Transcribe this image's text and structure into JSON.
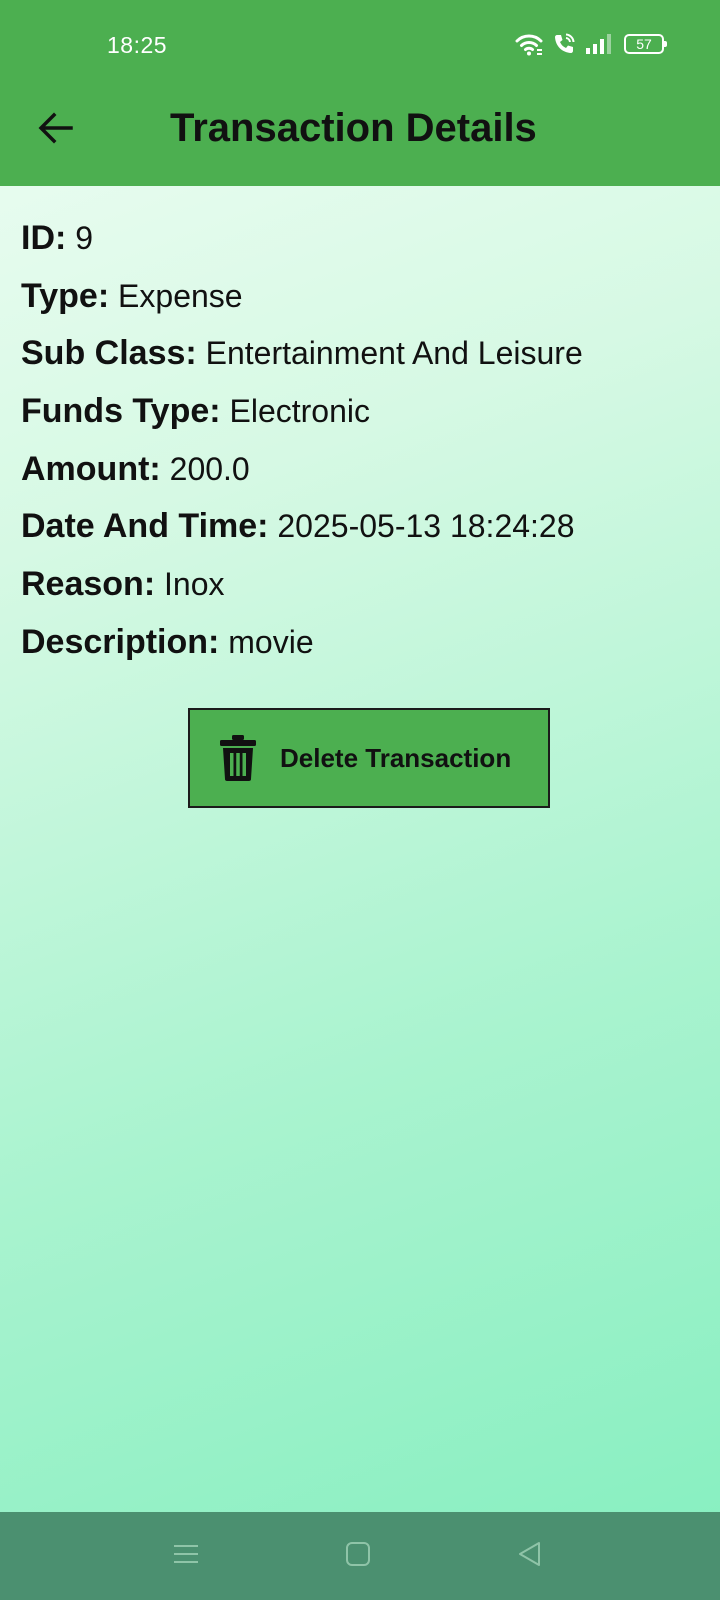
{
  "status_bar": {
    "time": "18:25",
    "battery_level": "57",
    "icons": [
      "wifi-icon",
      "wifi-calling-icon",
      "signal-icon",
      "battery-icon"
    ]
  },
  "app_bar": {
    "title": "Transaction Details",
    "back_icon": "arrow-back-icon",
    "background": "#4caf50"
  },
  "transaction": {
    "fields": [
      {
        "label": "ID:",
        "value": "9"
      },
      {
        "label": "Type:",
        "value": "Expense"
      },
      {
        "label": "Sub Class:",
        "value": "Entertainment And Leisure"
      },
      {
        "label": "Funds Type:",
        "value": "Electronic"
      },
      {
        "label": "Amount:",
        "value": "200.0"
      },
      {
        "label": "Date And Time:",
        "value": "2025-05-13 18:24:28"
      },
      {
        "label": "Reason:",
        "value": "Inox"
      },
      {
        "label": "Description:",
        "value": "movie"
      }
    ]
  },
  "actions": {
    "delete_label": "Delete Transaction",
    "delete_icon": "trash-icon"
  },
  "nav_bar": {
    "buttons": [
      "menu-icon",
      "home-icon",
      "back-triangle-icon"
    ],
    "background": "#4b9070"
  }
}
